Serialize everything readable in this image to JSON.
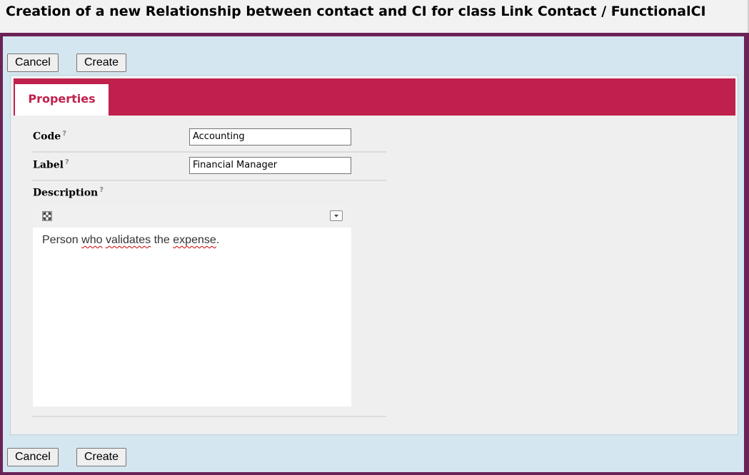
{
  "window": {
    "title": "Creation of a new Relationship between contact and CI for class Link Contact / FunctionalCI"
  },
  "toolbar_top": {
    "cancel_label": "Cancel",
    "create_label": "Create"
  },
  "toolbar_bottom": {
    "cancel_label": "Cancel",
    "create_label": "Create"
  },
  "tabs": [
    {
      "label": "Properties",
      "active": true
    }
  ],
  "form": {
    "code": {
      "label": "Code",
      "help": "?",
      "value": "Accounting"
    },
    "label": {
      "label": "Label",
      "help": "?",
      "value": "Financial Manager"
    },
    "description": {
      "label": "Description",
      "help": "?",
      "words": [
        "Person",
        "who",
        "validates",
        "the",
        "expense",
        "."
      ],
      "toolbar": {
        "maximize_icon": "maximize-icon",
        "menu_icon": "chevron-down-icon"
      }
    }
  },
  "colors": {
    "accent": "#c0204c",
    "frame_border": "#6b2357",
    "frame_background": "#d4e6ef"
  }
}
